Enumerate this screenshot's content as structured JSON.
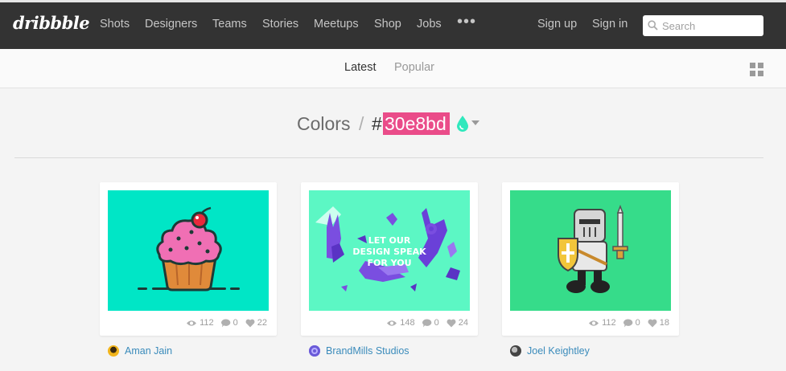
{
  "header": {
    "logo": "dribbble",
    "nav": [
      "Shots",
      "Designers",
      "Teams",
      "Stories",
      "Meetups",
      "Shop",
      "Jobs"
    ],
    "more": "•••",
    "sign_up": "Sign up",
    "sign_in": "Sign in",
    "search_placeholder": "Search"
  },
  "subnav": {
    "tabs": [
      "Latest",
      "Popular"
    ],
    "active": "Latest"
  },
  "heading": {
    "label": "Colors",
    "separator": "/",
    "hash": "#",
    "hex": "30e8bd",
    "hex_color": "#30e8bd",
    "highlight_color": "#ea4c89"
  },
  "shots": [
    {
      "views": "112",
      "comments": "0",
      "likes": "22",
      "author": "Aman Jain",
      "thumb_bg": "#00e6c6"
    },
    {
      "views": "148",
      "comments": "0",
      "likes": "24",
      "author": "BrandMills Studios",
      "thumb_bg": "#5cf7c4",
      "poster_text": [
        "LET OUR",
        "DESIGN SPEAK",
        "FOR YOU"
      ]
    },
    {
      "views": "112",
      "comments": "0",
      "likes": "18",
      "author": "Joel Keightley",
      "thumb_bg": "#36dc8a"
    }
  ],
  "colors": {
    "topbar": "#333333",
    "link_blue": "#3a8bbb",
    "accent_pink": "#ea4c89"
  }
}
